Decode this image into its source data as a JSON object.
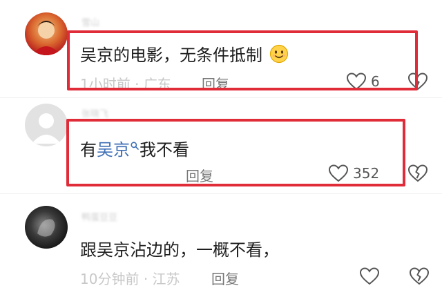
{
  "comments": [
    {
      "username": "雪山",
      "text": "吴京的电影，无条件抵制",
      "emoji": "smiling-face-icon",
      "time": "1小时前",
      "separator": "·",
      "location": "广东",
      "reply_label": "回复",
      "likes": "6"
    },
    {
      "username": "张晓飞",
      "text_prefix": "有",
      "text_link": "吴京",
      "text_suffix": "我不看",
      "reply_label": "回复",
      "likes": "352"
    },
    {
      "username": "鸭蛋豆豆",
      "text": "跟吴京沾边的，一概不看，",
      "time": "10分钟前",
      "separator": "·",
      "location": "江苏",
      "reply_label": "回复"
    }
  ],
  "colors": {
    "highlight_box": "#e02b38",
    "link": "#3f6fb5"
  }
}
